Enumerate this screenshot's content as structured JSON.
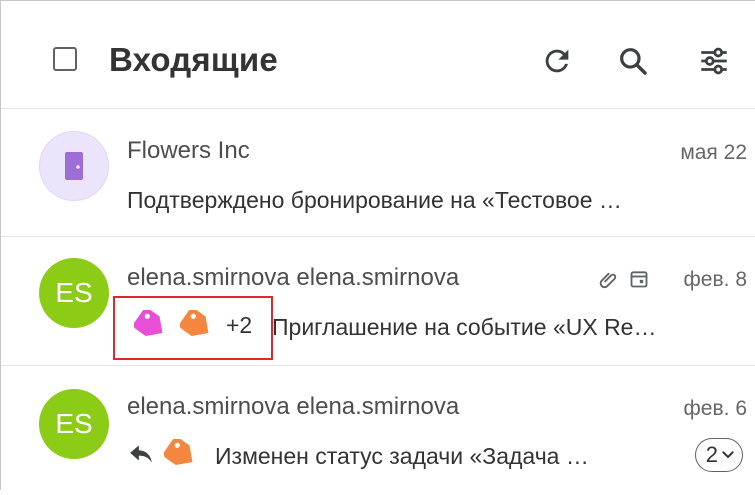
{
  "header": {
    "title": "Входящие",
    "icons": [
      "checkbox-icon",
      "refresh-icon",
      "search-icon",
      "filter-sliders-icon"
    ]
  },
  "messages": [
    {
      "sender": "Flowers Inc",
      "date": "мая 22",
      "subject": "Подтверждено бронирование на «Тестовое …",
      "avatar_icon": "door-icon",
      "avatar_color": "#ece4fb",
      "avatar_icon_color": "#9d6fd6"
    },
    {
      "sender": "elena.smirnova elena.smirnova",
      "date": "фев. 8",
      "avatar_initials": "ES",
      "avatar_color": "#8ccc16",
      "meta_icons": [
        "attachment-icon",
        "calendar-icon"
      ],
      "tags": [
        {
          "icon": "tag-icon",
          "color": "#e84fd6"
        },
        {
          "icon": "tag-icon",
          "color": "#f5863f"
        }
      ],
      "more_tags": "+2",
      "subject": "Приглашение на событие «UX Re…"
    },
    {
      "sender": "elena.smirnova elena.smirnova",
      "date": "фев. 6",
      "avatar_initials": "ES",
      "avatar_color": "#8ccc16",
      "reply_icon": "reply-icon",
      "tags": [
        {
          "icon": "tag-icon",
          "color": "#f5863f"
        }
      ],
      "subject": "Изменен статус задачи «Задача …",
      "thread_count": "2"
    }
  ],
  "annotation": {
    "highlight_color": "#e3262c"
  }
}
